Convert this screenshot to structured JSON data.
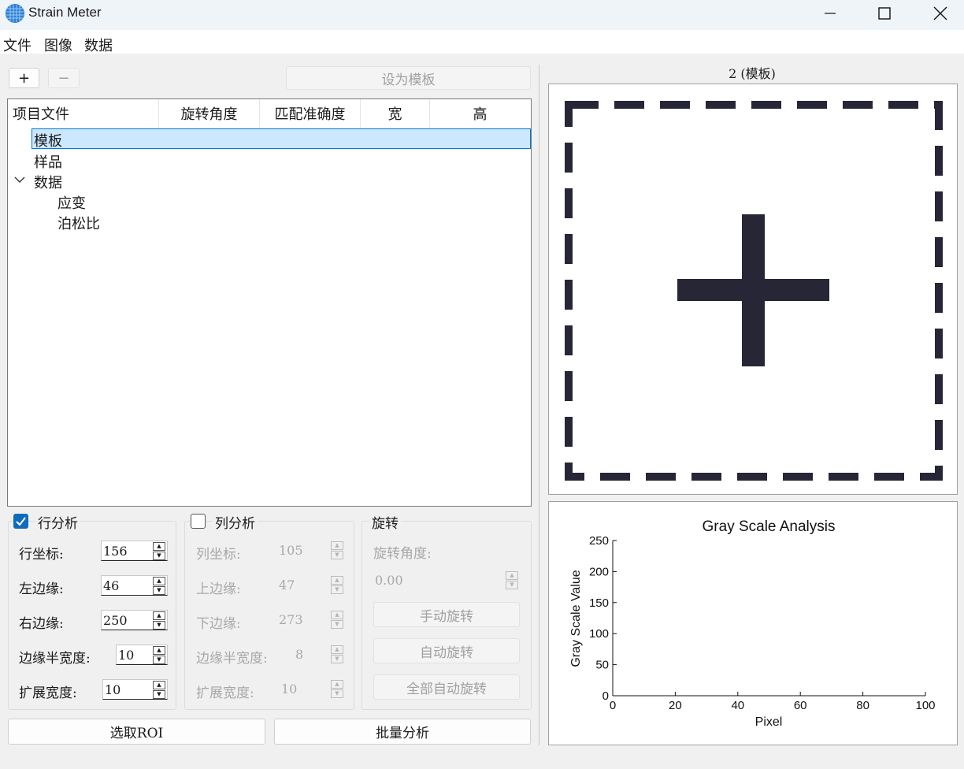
{
  "window": {
    "title": "Strain Meter"
  },
  "menu": [
    "文件",
    "图像",
    "数据"
  ],
  "toolbar": {
    "add": "+",
    "remove": "−",
    "set_template": "设为模板"
  },
  "tree": {
    "columns": [
      "项目文件",
      "旋转角度",
      "匹配准确度",
      "宽",
      "高"
    ],
    "items": [
      "模板",
      "样品",
      "数据"
    ],
    "children": [
      "应变",
      "泊松比"
    ],
    "expand_glyph": "⌄"
  },
  "row_analysis": {
    "checked": true,
    "title": "行分析",
    "labels": [
      "行坐标:",
      "左边缘:",
      "右边缘:",
      "边缘半宽度:",
      "扩展宽度:"
    ],
    "values": [
      "156",
      "46",
      "250",
      "10",
      "10"
    ]
  },
  "col_analysis": {
    "checked": false,
    "title": "列分析",
    "labels": [
      "列坐标:",
      "上边缘:",
      "下边缘:",
      "边缘半宽度:",
      "扩展宽度:"
    ],
    "values": [
      "105",
      "47",
      "273",
      "8",
      "10"
    ]
  },
  "rotation": {
    "title": "旋转",
    "angle_label": "旋转角度:",
    "angle_value": "0.00",
    "manual": "手动旋转",
    "auto": "自动旋转",
    "auto_all": "全部自动旋转"
  },
  "bottom": {
    "select_roi": "选取ROI",
    "batch": "批量分析"
  },
  "preview": {
    "title": "2 (模板)"
  },
  "colors": {
    "accent": "#0f6cbd",
    "selection": "#cce8ff",
    "selection_border": "#0078d7",
    "shape": "#262636"
  },
  "chart_data": {
    "type": "line",
    "title": "Gray Scale Analysis",
    "xlabel": "Pixel",
    "ylabel": "Gray Scale Value",
    "xlim": [
      0,
      100
    ],
    "ylim": [
      0,
      250
    ],
    "xticks": [
      0,
      20,
      40,
      60,
      80,
      100
    ],
    "yticks": [
      0,
      50,
      100,
      150,
      200,
      250
    ],
    "series": [],
    "grid": false
  }
}
